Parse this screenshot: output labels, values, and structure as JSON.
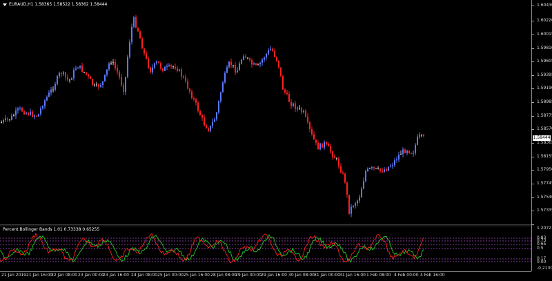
{
  "chart": {
    "symbol_line": "EURAUD,H1  1.58365 1.58522 1.58362 1.58444",
    "current_price": "1.58444",
    "price_ticks": [
      "1.60430",
      "1.60220",
      "1.60015",
      "1.59810",
      "1.59605",
      "1.59395",
      "1.59190",
      "1.58985",
      "1.58775",
      "1.58570",
      "1.58365",
      "1.58155",
      "1.57950",
      "1.57745",
      "1.57540",
      "1.57335",
      "1.57125"
    ],
    "time_labels": [
      "21 Jan 2019",
      "21 Jan 16:00",
      "22 Jan 08:00",
      "23 Jan 00:00",
      "23 Jan 16:00",
      "24 Jan 08:00",
      "25 Jan 00:00",
      "25 Jan 16:00",
      "28 Jan 08:00",
      "29 Jan 00:00",
      "29 Jan 16:00",
      "30 Jan 08:00",
      "31 Jan 00:00",
      "31 Jan 16:00",
      "1 Feb 08:00",
      "4 Feb 00:00",
      "4 Feb 16:00"
    ],
    "colors": {
      "bull": "#5a78ff",
      "bear": "#ff2020",
      "neutral": "#cccccc",
      "background": "#000000",
      "indicator_green": "#22cc22",
      "indicator_red": "#ff2020",
      "level_line": "#b050d0"
    }
  },
  "indicator": {
    "title": "Percent Bollinger Bands 1.01 0.73338 0.65255",
    "ticks": [
      "1.2072",
      "0.83",
      "0.73",
      "0.65",
      "0.5",
      "0.17",
      "0.00",
      "-0.21302"
    ]
  }
}
